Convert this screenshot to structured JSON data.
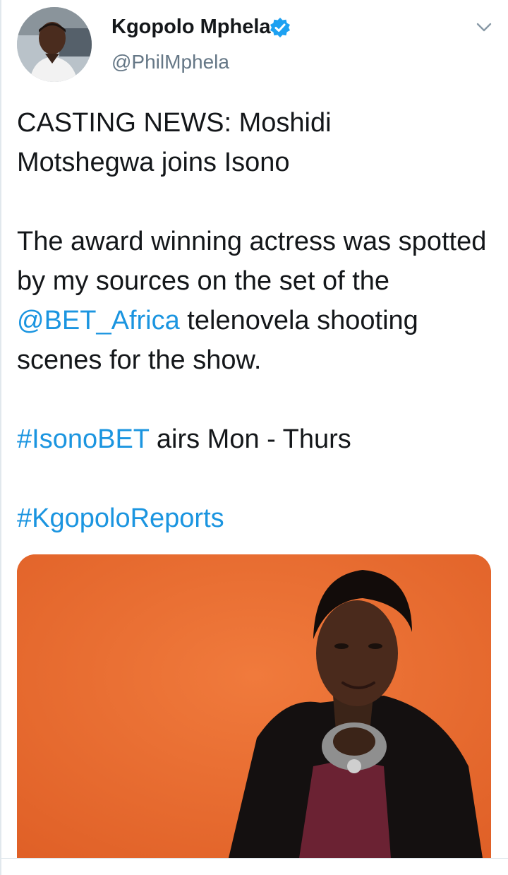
{
  "author": {
    "display_name": "Kgopolo Mphela",
    "handle": "@PhilMphela",
    "verified_icon": "verified-badge-icon",
    "avatar_icon": "profile-photo",
    "menu_icon": "chevron-down-icon"
  },
  "tweet": {
    "line1a": "CASTING NEWS: Moshidi",
    "line1b": "Motshegwa joins Isono",
    "para2_part1": "The award winning actress was spotted by my sources on the set of the ",
    "mention": "@BET_Africa",
    "para2_part2": " telenovela shooting scenes for the show.",
    "hashtag1": "#IsonoBET",
    "para3_part2": " airs Mon - Thurs",
    "hashtag2": "#KgopoloReports"
  },
  "media": {
    "description_icon": "photo-of-actress"
  },
  "colors": {
    "link": "#1b95e0",
    "text": "#14171a",
    "secondary_text": "#657786",
    "photo_background": "#e8692f"
  }
}
